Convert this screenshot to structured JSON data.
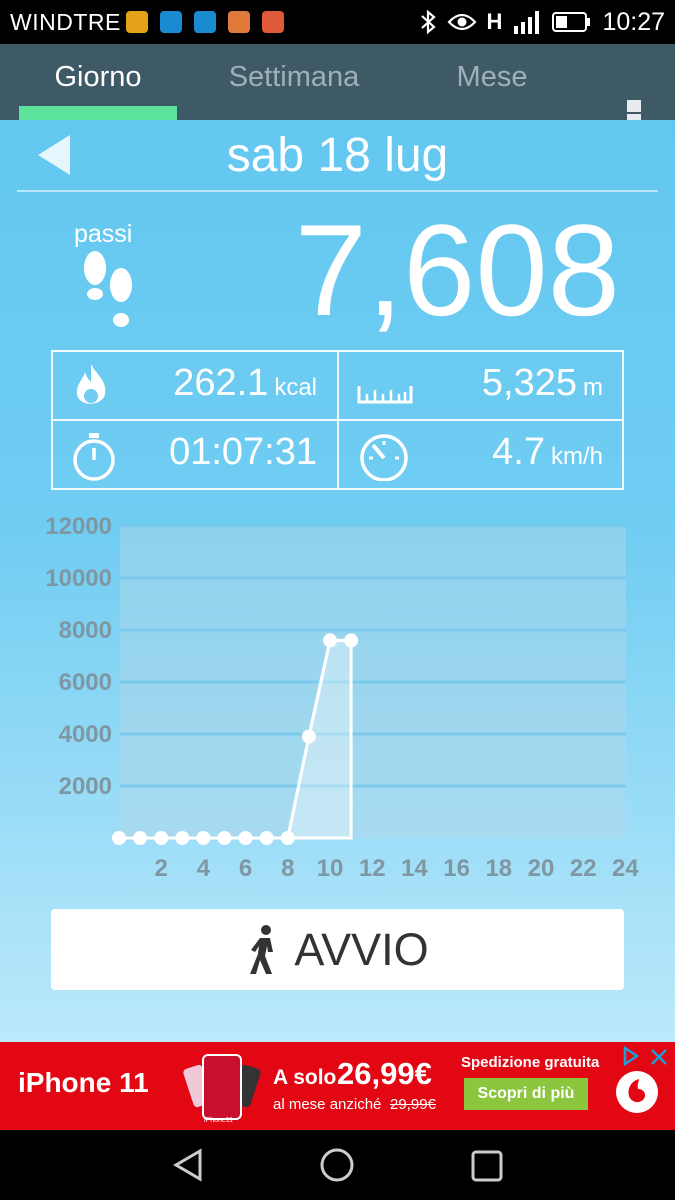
{
  "status_bar": {
    "carrier": "WINDTRE",
    "network_label": "H",
    "time": "10:27"
  },
  "tabs": [
    {
      "label": "Giorno",
      "active": true
    },
    {
      "label": "Settimana",
      "active": false
    },
    {
      "label": "Mese",
      "active": false
    }
  ],
  "header": {
    "date": "sab 18 lug"
  },
  "steps": {
    "label": "passi",
    "value": "7,608"
  },
  "stats": {
    "calories": {
      "value": "262.1",
      "unit": "kcal"
    },
    "distance": {
      "value": "5,325",
      "unit": "m"
    },
    "duration": {
      "value": "01:07:31",
      "unit": ""
    },
    "speed": {
      "value": "4.7",
      "unit": "km/h"
    }
  },
  "chart_data": {
    "type": "line",
    "x": [
      0,
      1,
      2,
      3,
      4,
      5,
      6,
      7,
      8,
      9,
      10,
      11
    ],
    "values": [
      0,
      0,
      0,
      0,
      0,
      0,
      0,
      0,
      0,
      3900,
      7600,
      7600
    ],
    "xticks": [
      "2",
      "4",
      "6",
      "8",
      "10",
      "12",
      "14",
      "16",
      "18",
      "20",
      "22",
      "24"
    ],
    "yticks": [
      "2000",
      "4000",
      "6000",
      "8000",
      "10000",
      "12000"
    ],
    "xlim": [
      0,
      24
    ],
    "ylim": [
      0,
      12000
    ],
    "grid": true,
    "colors": {
      "line": "#ffffff",
      "fill": "rgba(255,255,255,0.35)",
      "tick": "#7f97a3"
    }
  },
  "start_button": {
    "label": "AVVIO"
  },
  "ad": {
    "product": "iPhone 11",
    "price_prefix": "A solo",
    "price": "26,99€",
    "price_suffix": "al mese anziché",
    "old_price": "29,99€",
    "shipping": "Spedizione gratuita",
    "cta": "Scopri di più",
    "tiny_label": "iPhone11"
  },
  "colors": {
    "tab_bar": "#3d5a66",
    "tab_indicator": "#5ce39a",
    "background_top": "#63c7f0",
    "ad_red": "#e30613",
    "ad_cta_green": "#8cc63f"
  }
}
